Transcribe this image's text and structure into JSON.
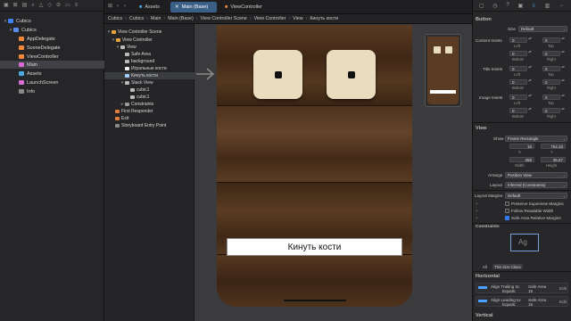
{
  "navigator": {
    "items": [
      {
        "label": "Cubics",
        "icon": "project-icon",
        "indent": 0
      },
      {
        "label": "Cubics",
        "icon": "folder-icon",
        "indent": 1
      },
      {
        "label": "AppDelegate",
        "icon": "swift-file-icon",
        "indent": 2
      },
      {
        "label": "SceneDelegate",
        "icon": "swift-file-icon",
        "indent": 2
      },
      {
        "label": "ViewController",
        "icon": "swift-file-icon",
        "indent": 2
      },
      {
        "label": "Main",
        "icon": "storyboard-icon",
        "indent": 2
      },
      {
        "label": "Assets",
        "icon": "assets-icon",
        "indent": 2
      },
      {
        "label": "LaunchScreen",
        "icon": "storyboard-icon",
        "indent": 2
      },
      {
        "label": "Info",
        "icon": "plist-icon",
        "indent": 2
      }
    ],
    "selected_index": 5
  },
  "tabs": [
    {
      "label": "Assets",
      "active": false
    },
    {
      "label": "Main (Base)",
      "active": true
    },
    {
      "label": "ViewController",
      "active": false
    }
  ],
  "jumpbar": [
    "Cubics",
    "Cubics",
    "Main",
    "Main (Base)",
    "View Controller Scene",
    "View Controller",
    "View",
    "Кинуть кости"
  ],
  "outline": {
    "items": [
      {
        "label": "View Controller Scene",
        "indent": 0,
        "icon": "scene-icon"
      },
      {
        "label": "View Controller",
        "indent": 1,
        "icon": "view-controller-icon"
      },
      {
        "label": "View",
        "indent": 2,
        "icon": "view-icon"
      },
      {
        "label": "Safe Area",
        "indent": 3,
        "icon": "safe-area-icon"
      },
      {
        "label": "background",
        "indent": 3,
        "icon": "image-view-icon"
      },
      {
        "label": "Игральные кости",
        "indent": 3,
        "icon": "label-icon"
      },
      {
        "label": "Кинуть кости",
        "indent": 3,
        "icon": "button-icon"
      },
      {
        "label": "Stack View",
        "indent": 3,
        "icon": "stack-view-icon"
      },
      {
        "label": "cubic1",
        "indent": 4,
        "icon": "image-view-icon"
      },
      {
        "label": "cubic1",
        "indent": 4,
        "icon": "image-view-icon"
      },
      {
        "label": "Constraints",
        "indent": 3,
        "icon": "constraints-icon"
      },
      {
        "label": "First Responder",
        "indent": 1,
        "icon": "first-responder-icon"
      },
      {
        "label": "Exit",
        "indent": 1,
        "icon": "exit-icon"
      },
      {
        "label": "Storyboard Entry Point",
        "indent": 1,
        "icon": "entry-point-icon"
      }
    ],
    "selected_index": 6
  },
  "canvas": {
    "button_title": "Кинуть кости",
    "dice": [
      "die-one",
      "die-one"
    ]
  },
  "inspector": {
    "button_section": "Button",
    "size_label": "Size",
    "size_value": "Default",
    "content_insets_label": "Content Insets",
    "title_insets_label": "Title Insets",
    "image_insets_label": "Image Insets",
    "inset_values": [
      "0",
      "0",
      "0",
      "0"
    ],
    "inset_sub": [
      "Left",
      "Top",
      "Bottom",
      "Right"
    ],
    "view_section": "View",
    "show_label": "Show",
    "show_value": "Frame Rectangle",
    "x_value": "16",
    "y_value": "754,33",
    "x_label": "X",
    "y_label": "Y",
    "width_value": "358",
    "height_value": "35,67",
    "width_label": "Width",
    "height_label": "Height",
    "arrange_label": "Arrange",
    "arrange_value": "Position View",
    "layout_label": "Layout",
    "layout_value": "Inferred (Constraints)",
    "layout_margins_label": "Layout Margins",
    "layout_margins_value": "Default",
    "preserve_label": "Preserve Superview Margins",
    "follow_label": "Follow Readable Width",
    "safe_area_label": "Safe Area Relative Margins",
    "constraints_section": "Constraints",
    "constraint_preview": "Ag",
    "filter_all": "All",
    "filter_size_class": "This Size Class",
    "horizontal_section": "Horizontal",
    "vertical_section": "Vertical",
    "constraints": [
      {
        "title": "Align Trailing to:",
        "target": "Safe Area",
        "equals_label": "Equals:",
        "equals": "16",
        "action": "Edit"
      },
      {
        "title": "Align Leading to:",
        "target": "Safe Area",
        "equals_label": "Equals:",
        "equals": "16",
        "action": "Edit"
      }
    ]
  },
  "colors": {
    "accent": "#3478f6",
    "wood": "#4a2f1c",
    "die": "#e9dcbf"
  }
}
